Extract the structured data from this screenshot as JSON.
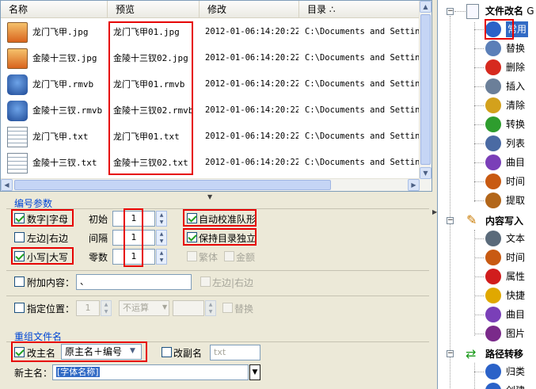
{
  "file_list": {
    "columns": [
      "名称",
      "预览",
      "修改",
      "目录 ∴"
    ],
    "rows": [
      {
        "name": "龙门飞甲.jpg",
        "preview": "龙门飞甲01.jpg",
        "modified": "2012-01-06:14:20:22",
        "dir": "C:\\Documents and Settings\\A",
        "icon": "jpg-image-icon"
      },
      {
        "name": "金陵十三钗.jpg",
        "preview": "金陵十三钗02.jpg",
        "modified": "2012-01-06:14:20:22",
        "dir": "C:\\Documents and Settings\\A",
        "icon": "jpg-image-icon"
      },
      {
        "name": "龙门飞甲.rmvb",
        "preview": "龙门飞甲01.rmvb",
        "modified": "2012-01-06:14:20:22",
        "dir": "C:\\Documents and Settings\\A",
        "icon": "realmedia-icon"
      },
      {
        "name": "金陵十三钗.rmvb",
        "preview": "金陵十三钗02.rmvb",
        "modified": "2012-01-06:14:20:22",
        "dir": "C:\\Documents and Settings\\A",
        "icon": "realmedia-icon"
      },
      {
        "name": "龙门飞甲.txt",
        "preview": "龙门飞甲01.txt",
        "modified": "2012-01-06:14:20:22",
        "dir": "C:\\Documents and Settings\\A",
        "icon": "text-file-icon"
      },
      {
        "name": "金陵十三钗.txt",
        "preview": "金陵十三钗02.txt",
        "modified": "2012-01-06:14:20:22",
        "dir": "C:\\Documents and Settings\\A",
        "icon": "text-file-icon"
      }
    ]
  },
  "numbering": {
    "title": "编号参数",
    "digit_letter": "数字|字母",
    "left_right": "左边|右边",
    "lower_upper": "小写|大写",
    "start_label": "初始",
    "start_value": "1",
    "step_label": "间隔",
    "step_value": "1",
    "zeros_label": "零数",
    "zeros_value": "1",
    "auto_align": "自动校准队形",
    "keep_dir": "保持目录独立",
    "traditional": "繁体",
    "amount": "金额",
    "append_label": "附加内容：",
    "append_value": "、",
    "append_side": "左边|右边",
    "position_label": "指定位置：",
    "position_value": "1",
    "operation_value": "不运算",
    "replace_label": "替换"
  },
  "regroup": {
    "title": "重组文件名",
    "rename_main": "改主名",
    "main_select": "原主名＋编号",
    "rename_ext": "改副名",
    "ext_placeholder": "txt",
    "new_main_label": "新主名：",
    "new_main_value": "[字体名称]"
  },
  "tree": {
    "root": "文件改名",
    "root_suffix": "G",
    "items": [
      {
        "label": "常用",
        "icon": "info-icon"
      },
      {
        "label": "替换",
        "icon": "replace-icon"
      },
      {
        "label": "删除",
        "icon": "delete-icon"
      },
      {
        "label": "插入",
        "icon": "insert-icon"
      },
      {
        "label": "清除",
        "icon": "broom-icon"
      },
      {
        "label": "转换",
        "icon": "convert-icon"
      },
      {
        "label": "列表",
        "icon": "list-icon"
      },
      {
        "label": "曲目",
        "icon": "music-icon"
      },
      {
        "label": "时间",
        "icon": "clock-icon"
      },
      {
        "label": "提取",
        "icon": "extract-icon"
      }
    ],
    "section2": "内容写入",
    "items2": [
      {
        "label": "文本",
        "icon": "text-icon"
      },
      {
        "label": "时间",
        "icon": "clock-icon"
      },
      {
        "label": "属性",
        "icon": "hand-icon"
      },
      {
        "label": "快捷",
        "icon": "shortcut-icon"
      },
      {
        "label": "曲目",
        "icon": "music-icon"
      },
      {
        "label": "图片",
        "icon": "picture-icon"
      }
    ],
    "section3": "路径转移",
    "items3": [
      {
        "label": "归类",
        "icon": "classify-icon"
      },
      {
        "label": "创建",
        "icon": "create-icon"
      }
    ]
  },
  "colors": {
    "accent": "#0046d5",
    "highlight": "#e60000",
    "selected": "#316ac5"
  }
}
